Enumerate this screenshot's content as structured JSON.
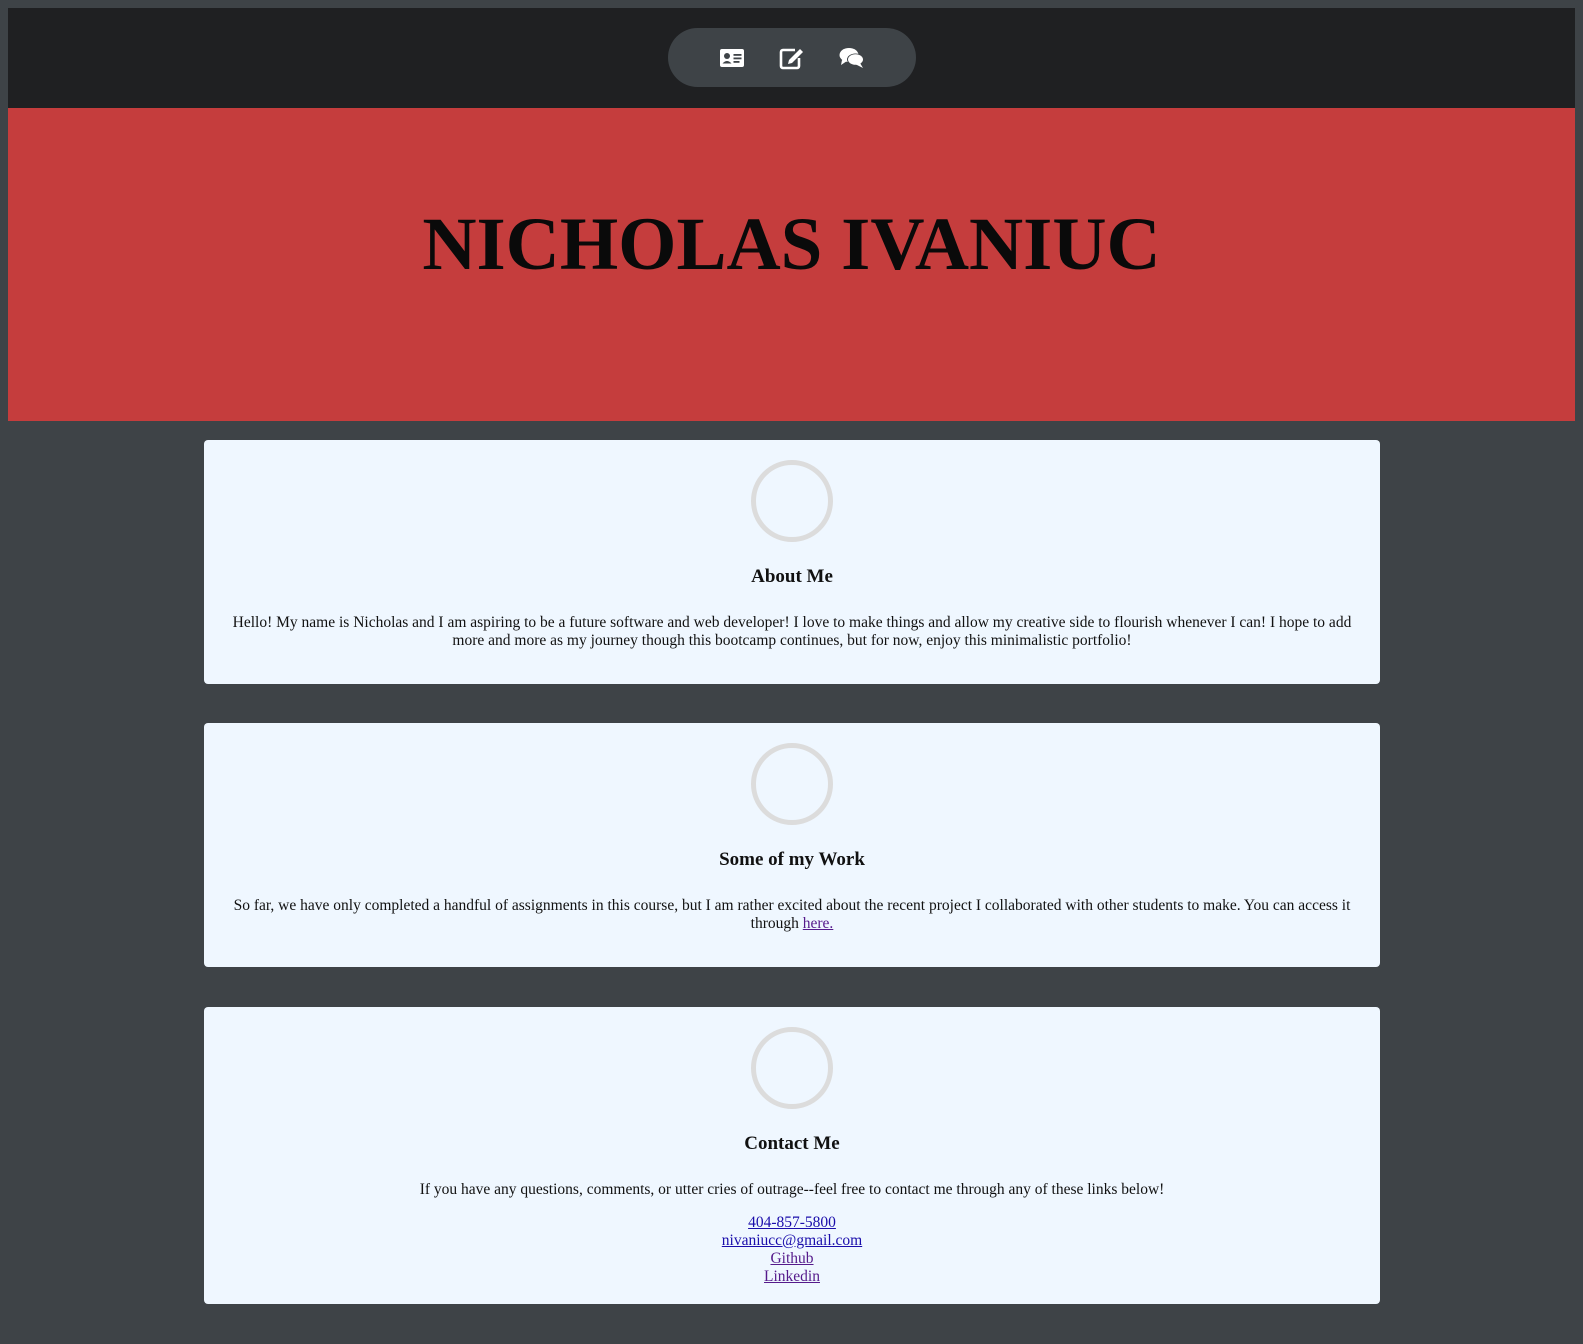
{
  "nav": {
    "items": [
      {
        "icon": "id-card-icon",
        "name": "nav-about"
      },
      {
        "icon": "edit-icon",
        "name": "nav-work"
      },
      {
        "icon": "comments-icon",
        "name": "nav-contact"
      }
    ]
  },
  "hero": {
    "title": "NICHOLAS IVANIUC"
  },
  "about": {
    "heading": "About Me",
    "text": "Hello! My name is Nicholas and I am aspiring to be a future software and web developer! I love to make things and allow my creative side to flourish whenever I can! I hope to add more and more as my journey though this bootcamp continues, but for now, enjoy this minimalistic portfolio!"
  },
  "work": {
    "heading": "Some of my Work",
    "text": "So far, we have only completed a handful of assignments in this course, but I am rather excited about the recent project I collaborated with other students to make. You can access it through ",
    "link_label": "here."
  },
  "contact": {
    "heading": "Contact Me",
    "text": "If you have any questions, comments, or utter cries of outrage--feel free to contact me through any of these links below!",
    "links": {
      "phone": "404-857-5800",
      "email": "nivaniucc@gmail.com",
      "github": "Github",
      "linkedin": "Linkedin"
    }
  },
  "colors": {
    "page_bg": "#3e4347",
    "topbar_bg": "#1f2022",
    "hero_bg": "#c53d3d",
    "card_bg": "#eff7ff",
    "ring": "#dcdcdc"
  }
}
